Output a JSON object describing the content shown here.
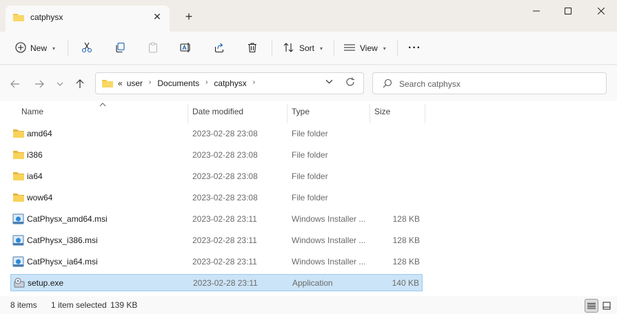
{
  "window": {
    "tab_title": "catphysx",
    "new_tab": "+",
    "close_tab": "✕"
  },
  "toolbar": {
    "new_label": "New",
    "sort_label": "Sort",
    "view_label": "View",
    "more_label": "···"
  },
  "address": {
    "overflow": "«",
    "crumbs": [
      "user",
      "Documents",
      "catphysx"
    ],
    "separator": "›"
  },
  "search": {
    "placeholder": "Search catphysx"
  },
  "columns": {
    "name": "Name",
    "date": "Date modified",
    "type": "Type",
    "size": "Size"
  },
  "files": [
    {
      "name": "amd64",
      "date": "2023-02-28 23:08",
      "type": "File folder",
      "size": "",
      "icon": "folder-icon"
    },
    {
      "name": "i386",
      "date": "2023-02-28 23:08",
      "type": "File folder",
      "size": "",
      "icon": "folder-icon"
    },
    {
      "name": "ia64",
      "date": "2023-02-28 23:08",
      "type": "File folder",
      "size": "",
      "icon": "folder-icon"
    },
    {
      "name": "wow64",
      "date": "2023-02-28 23:08",
      "type": "File folder",
      "size": "",
      "icon": "folder-icon"
    },
    {
      "name": "CatPhysx_amd64.msi",
      "date": "2023-02-28 23:11",
      "type": "Windows Installer ...",
      "size": "128 KB",
      "icon": "msi-icon"
    },
    {
      "name": "CatPhysx_i386.msi",
      "date": "2023-02-28 23:11",
      "type": "Windows Installer ...",
      "size": "128 KB",
      "icon": "msi-icon"
    },
    {
      "name": "CatPhysx_ia64.msi",
      "date": "2023-02-28 23:11",
      "type": "Windows Installer ...",
      "size": "128 KB",
      "icon": "msi-icon"
    },
    {
      "name": "setup.exe",
      "date": "2023-02-28 23:11",
      "type": "Application",
      "size": "140 KB",
      "icon": "setup-exe-icon",
      "selected": true
    }
  ],
  "status": {
    "item_count": "8 items",
    "selection": "1 item selected",
    "selection_size": "139 KB"
  },
  "colors": {
    "folder": "#f4c542",
    "selected_row": "#cce4f7",
    "selected_border": "#99c9ef",
    "accent": "#0067c0"
  }
}
